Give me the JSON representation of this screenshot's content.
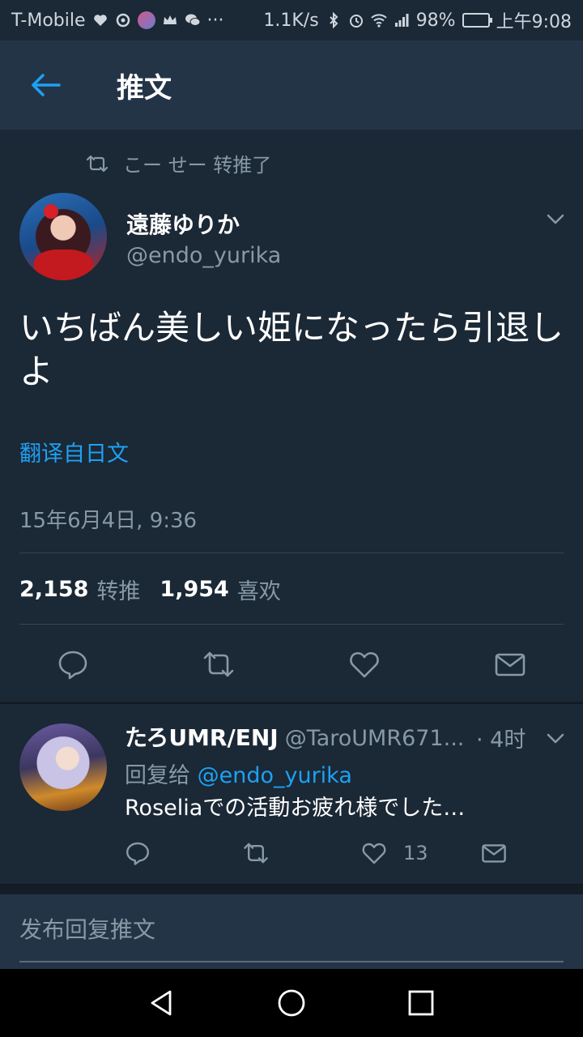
{
  "status_bar": {
    "carrier": "T-Mobile",
    "more": "···",
    "speed": "1.1K/s",
    "battery_pct": "98%",
    "battery_level": 0.98,
    "time": "上午9:08"
  },
  "header": {
    "title": "推文"
  },
  "tweet": {
    "retweeted_by": "こー せー 转推了",
    "display_name": "遠藤ゆりか",
    "handle": "@endo_yurika",
    "text": "いちばん美しい姫になったら引退しよ",
    "translate": "翻译自日文",
    "timestamp": "15年6月4日, 9:36",
    "retweet_count": "2,158",
    "retweet_label": "转推",
    "like_count": "1,954",
    "like_label": "喜欢"
  },
  "reply": {
    "display_name": "たろUMR/ENJ",
    "handle": "@TaroUMR671...",
    "time": "· 4时",
    "reply_prefix": "回复给",
    "reply_to": "@endo_yurika",
    "text": "Roseliaでの活動お疲れ様でした…",
    "like_count": "13"
  },
  "compose": {
    "placeholder": "发布回复推文"
  },
  "colors": {
    "accent": "#1da1f2",
    "background": "#1b2836",
    "header": "#243447",
    "muted": "#8899a6"
  }
}
